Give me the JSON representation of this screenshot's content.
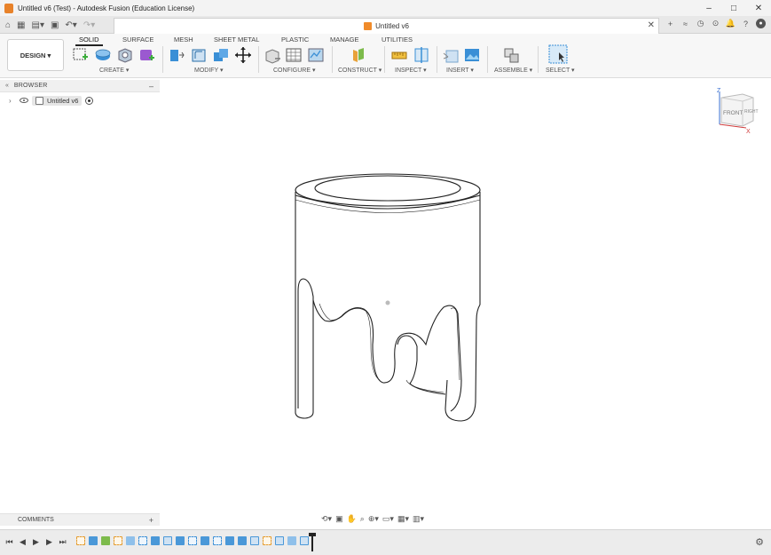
{
  "window": {
    "title": "Untitled v6 (Test) - Autodesk Fusion (Education License)",
    "controls": [
      "–",
      "□",
      "✕"
    ]
  },
  "document_tab": {
    "title": "Untitled v6",
    "close": "✕"
  },
  "tab_right": [
    "+",
    "≈",
    "◷",
    "⊙",
    "🔔",
    "?"
  ],
  "design_button": "DESIGN ▾",
  "ribbon_tabs": [
    "SOLID",
    "SURFACE",
    "MESH",
    "SHEET METAL",
    "PLASTIC",
    "MANAGE",
    "UTILITIES"
  ],
  "groups": {
    "create": "CREATE ▾",
    "modify": "MODIFY ▾",
    "configure": "CONFIGURE ▾",
    "construct": "CONSTRUCT ▾",
    "inspect": "INSPECT ▾",
    "insert": "INSERT ▾",
    "assemble": "ASSEMBLE ▾",
    "select": "SELECT ▾"
  },
  "browser": {
    "header": "BROWSER",
    "root_item": "Untitled v6"
  },
  "viewcube": {
    "face_front": "FRONT",
    "face_right": "RIGHT",
    "axis_z": "Z",
    "axis_x": "X"
  },
  "comments": {
    "label": "COMMENTS",
    "add": "+"
  },
  "colors": {
    "accent_orange": "#e8822a",
    "tool_blue": "#3a8fd6",
    "tool_green": "#4caf50",
    "tool_purple": "#9b59d0"
  }
}
